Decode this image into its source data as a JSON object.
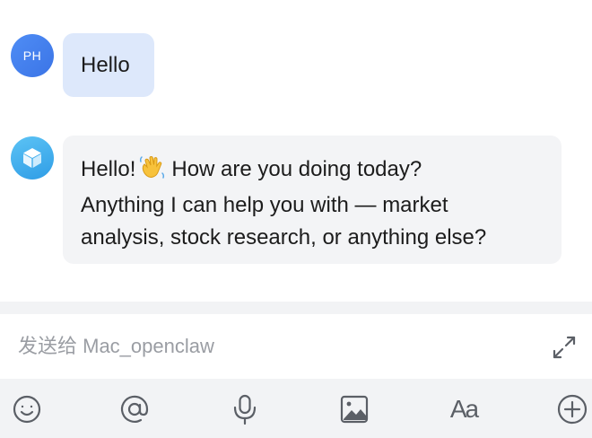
{
  "conversation": {
    "user": {
      "avatar_initials": "PH",
      "message": "Hello"
    },
    "bot": {
      "avatar_icon": "cube-icon",
      "message_lines": [
        "Hello!",
        "How are you doing today?",
        "Anything I can help you with — market",
        "analysis, stock research, or anything else?"
      ],
      "inline_emoji": "waving-hand-icon"
    }
  },
  "composer": {
    "placeholder": "发送给 Mac_openclaw",
    "value": "",
    "expand_icon": "expand-icon"
  },
  "toolbar": {
    "items": [
      {
        "icon": "emoji-icon"
      },
      {
        "icon": "mention-icon"
      },
      {
        "icon": "microphone-icon"
      },
      {
        "icon": "image-icon"
      },
      {
        "icon": "font-format-icon",
        "label": "Aa"
      },
      {
        "icon": "plus-circle-icon"
      }
    ]
  },
  "colors": {
    "user_bubble": "#dde8fb",
    "bot_bubble": "#f3f4f6",
    "user_avatar": "#3b74e6",
    "bot_avatar": "#2f9de6",
    "toolbar_bg": "#f2f3f5",
    "icon_gray": "#5b5f66",
    "placeholder_gray": "#9a9da3"
  }
}
